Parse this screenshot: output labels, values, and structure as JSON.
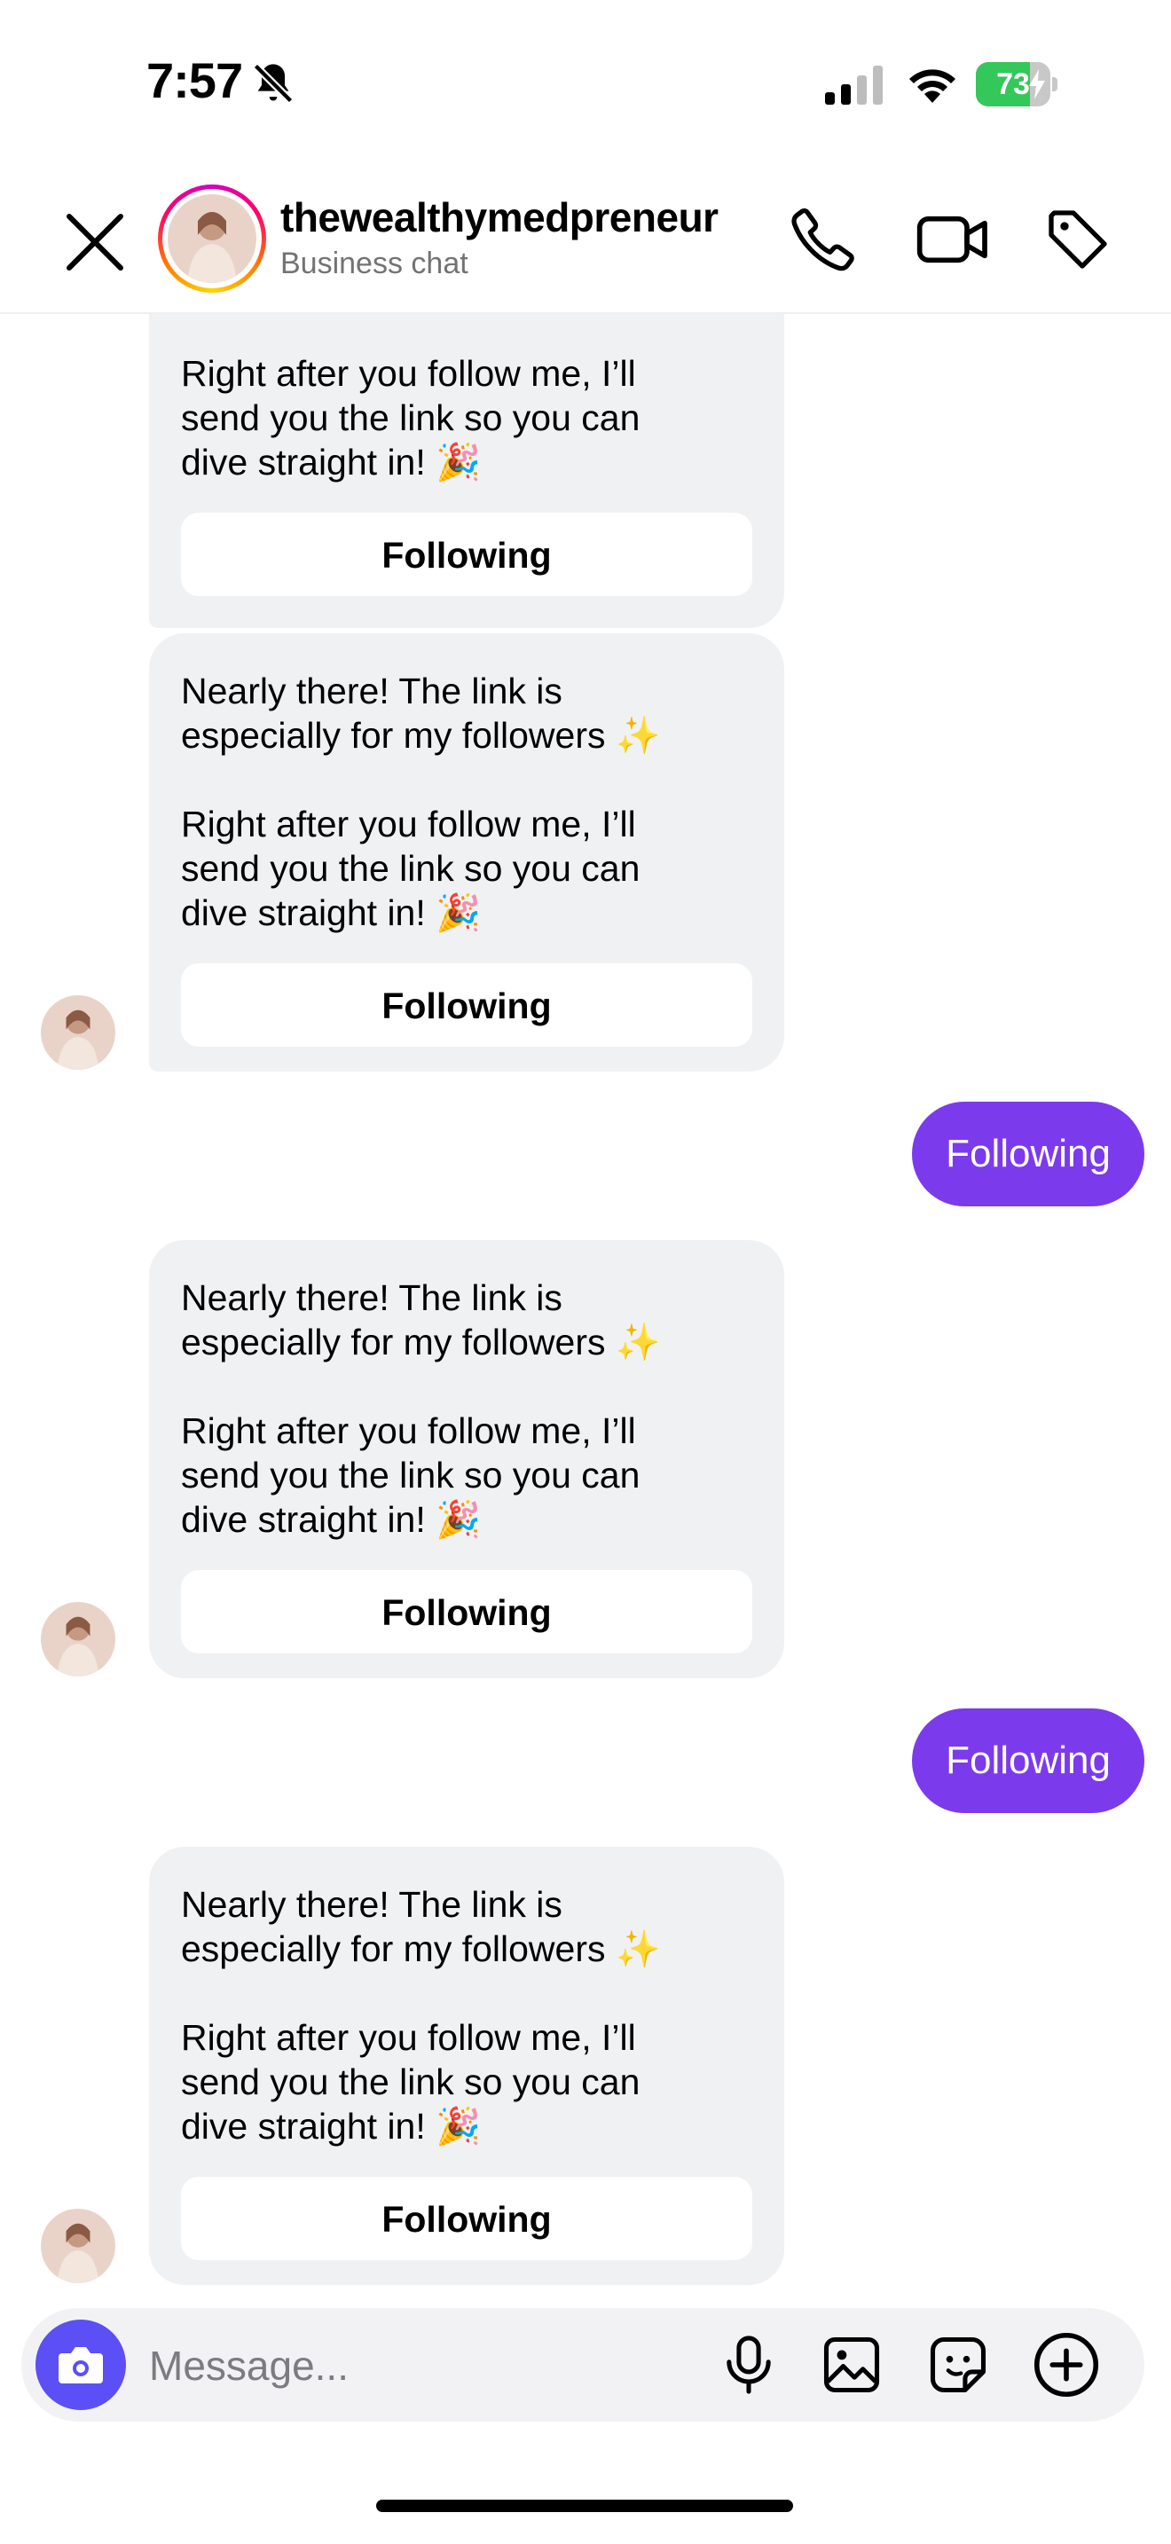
{
  "status_bar": {
    "time": "7:57",
    "battery_percent": "73",
    "battery_level": 0.73
  },
  "header": {
    "username": "thewealthymedpreneur",
    "subtitle": "Business chat"
  },
  "messages": [
    {
      "from": "them",
      "text": "Right after you follow me, I’ll\nsend you the link so you can\ndive straight in! 🎉",
      "button": "Following"
    },
    {
      "from": "them",
      "text": "Nearly there! The link is\nespecially for my followers ✨\n\nRight after you follow me, I’ll\nsend you the link so you can\ndive straight in! 🎉",
      "button": "Following"
    },
    {
      "from": "me",
      "text": "Following"
    },
    {
      "from": "them",
      "text": "Nearly there! The link is\nespecially for my followers ✨\n\nRight after you follow me, I’ll\nsend you the link so you can\ndive straight in! 🎉",
      "button": "Following"
    },
    {
      "from": "me",
      "text": "Following"
    },
    {
      "from": "them",
      "text": "Nearly there! The link is\nespecially for my followers ✨\n\nRight after you follow me, I’ll\nsend you the link so you can\ndive straight in! 🎉",
      "button": "Following"
    }
  ],
  "composer": {
    "placeholder": "Message..."
  },
  "colors": {
    "sent_bubble": "#7c3aed",
    "received_bubble": "#f0f1f3",
    "camera_button": "#5b4ff5",
    "battery_fill": "#34c759"
  },
  "icons": [
    "bell-slash-icon",
    "signal-icon",
    "wifi-icon",
    "battery-icon",
    "close-icon",
    "phone-icon",
    "video-camera-icon",
    "tag-icon",
    "camera-icon",
    "microphone-icon",
    "image-icon",
    "sticker-icon",
    "plus-circle-icon"
  ]
}
